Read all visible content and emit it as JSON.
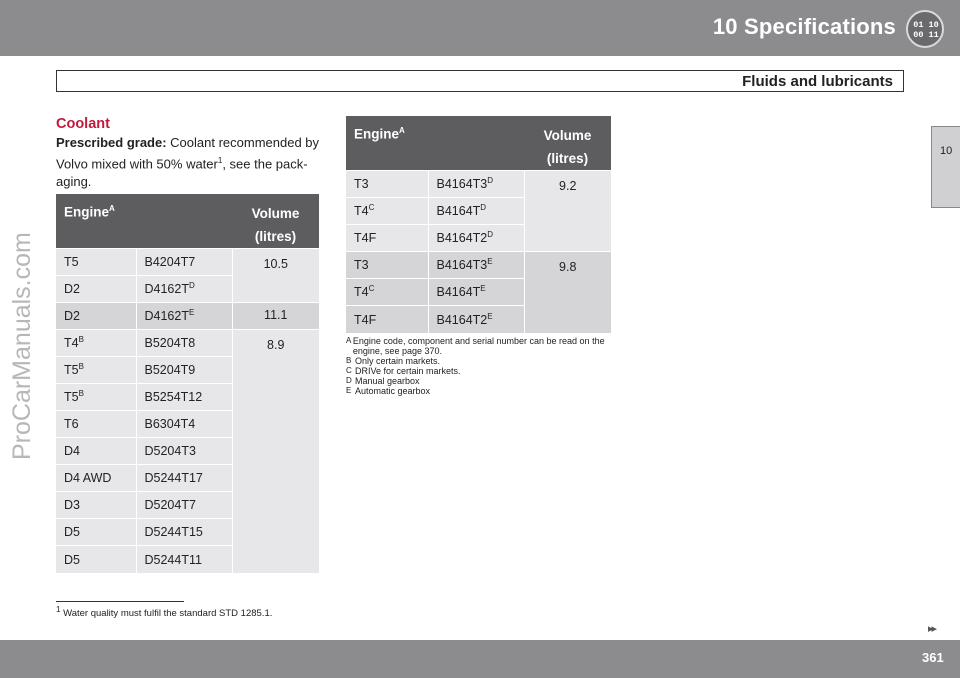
{
  "header": {
    "chapter_title": "10 Specifications",
    "icon_lines": [
      "01 10",
      "00 11"
    ]
  },
  "section": {
    "title": "Fluids and lubricants"
  },
  "side_tab": {
    "label": "10"
  },
  "watermark": "ProCarManuals.com",
  "coolant": {
    "heading": "Coolant",
    "prescribed_label": "Prescribed grade:",
    "prescribed_text_1": " Coolant recommended by Volvo mixed with 50% water",
    "prescribed_sup": "1",
    "prescribed_text_2": ", see the pack-aging."
  },
  "table_left": {
    "header_engine": "Engine",
    "header_engine_sup": "A",
    "header_volume_1": "Volume",
    "header_volume_2": "(litres)",
    "rows": [
      {
        "model": "T5",
        "model_sup": "",
        "code": "B4204T7",
        "code_sup": ""
      },
      {
        "model": "D2",
        "model_sup": "",
        "code": "D4162T",
        "code_sup": "D"
      },
      {
        "model": "D2",
        "model_sup": "",
        "code": "D4162T",
        "code_sup": "E"
      },
      {
        "model": "T4",
        "model_sup": "B",
        "code": "B5204T8",
        "code_sup": ""
      },
      {
        "model": "T5",
        "model_sup": "B",
        "code": "B5204T9",
        "code_sup": ""
      },
      {
        "model": "T5",
        "model_sup": "B",
        "code": "B5254T12",
        "code_sup": ""
      },
      {
        "model": "T6",
        "model_sup": "",
        "code": "B6304T4",
        "code_sup": ""
      },
      {
        "model": "D4",
        "model_sup": "",
        "code": "D5204T3",
        "code_sup": ""
      },
      {
        "model": "D4 AWD",
        "model_sup": "",
        "code": "D5244T17",
        "code_sup": ""
      },
      {
        "model": "D3",
        "model_sup": "",
        "code": "D5204T7",
        "code_sup": ""
      },
      {
        "model": "D5",
        "model_sup": "",
        "code": "D5244T15",
        "code_sup": ""
      },
      {
        "model": "D5",
        "model_sup": "",
        "code": "D5244T11",
        "code_sup": ""
      }
    ],
    "volumes": [
      "10.5",
      "11.1",
      "8.9"
    ]
  },
  "table_right": {
    "header_engine": "Engine",
    "header_engine_sup": "A",
    "header_volume_1": "Volume",
    "header_volume_2": "(litres)",
    "rows": [
      {
        "model": "T3",
        "model_sup": "",
        "code": "B4164T3",
        "code_sup": "D"
      },
      {
        "model": "T4",
        "model_sup": "C",
        "code": "B4164T",
        "code_sup": "D"
      },
      {
        "model": "T4F",
        "model_sup": "",
        "code": "B4164T2",
        "code_sup": "D"
      },
      {
        "model": "T3",
        "model_sup": "",
        "code": "B4164T3",
        "code_sup": "E"
      },
      {
        "model": "T4",
        "model_sup": "C",
        "code": "B4164T",
        "code_sup": "E"
      },
      {
        "model": "T4F",
        "model_sup": "",
        "code": "B4164T2",
        "code_sup": "E"
      }
    ],
    "volumes": [
      "9.2",
      "9.8"
    ]
  },
  "footnotes": [
    {
      "key": "A",
      "text": "Engine code, component and serial number can be read on the engine, see page 370."
    },
    {
      "key": "B",
      "text": "Only certain markets."
    },
    {
      "key": "C",
      "text": "DRIVe for certain markets."
    },
    {
      "key": "D",
      "text": "Manual gearbox"
    },
    {
      "key": "E",
      "text": "Automatic gearbox"
    }
  ],
  "page_footnote": {
    "num": "1",
    "text": "Water quality must fulfil the standard STD 1285.1."
  },
  "footer": {
    "arrows": "▸▸",
    "page_number": "361"
  }
}
